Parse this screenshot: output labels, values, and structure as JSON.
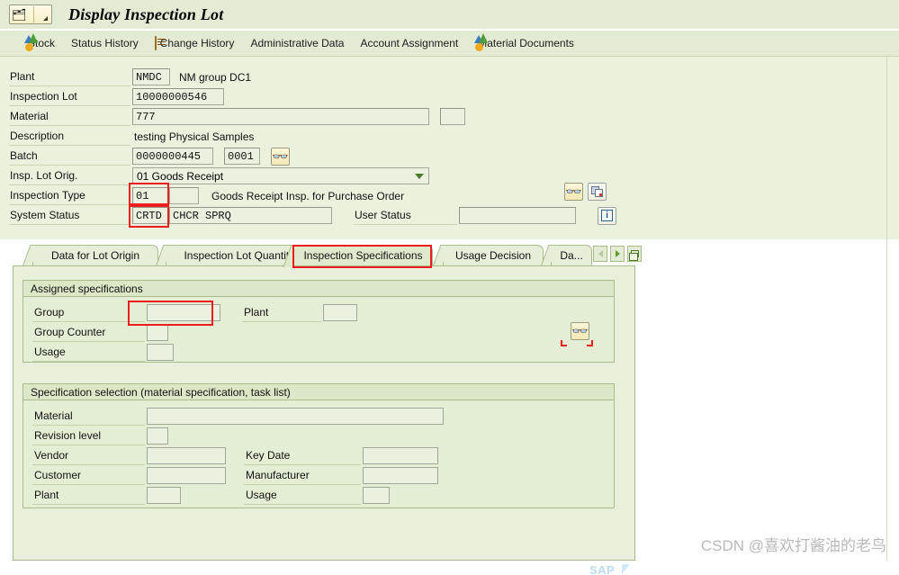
{
  "window": {
    "title": "Display Inspection Lot",
    "system_button_icon": "sap-system-menu-icon"
  },
  "toolbar": {
    "items": [
      {
        "label": "Stock",
        "icon": "stock-mountain-icon"
      },
      {
        "label": "Status History",
        "icon": ""
      },
      {
        "label": "Change History",
        "icon": "scroll-icon"
      },
      {
        "label": "Administrative Data",
        "icon": ""
      },
      {
        "label": "Account Assignment",
        "icon": ""
      },
      {
        "label": "Material Documents",
        "icon": "stock-mountain-icon"
      }
    ]
  },
  "header_form": {
    "plant": {
      "label": "Plant",
      "value": "NMDC",
      "description": "NM group DC1"
    },
    "inspection_lot": {
      "label": "Inspection Lot",
      "value": "10000000546"
    },
    "material": {
      "label": "Material",
      "value": "777",
      "extra_value": ""
    },
    "description": {
      "label": "Description",
      "value": "testing Physical Samples"
    },
    "batch": {
      "label": "Batch",
      "value": "0000000445",
      "sub_value": "0001",
      "button_icon": "glasses-display-icon"
    },
    "insp_lot_orig": {
      "label": "Insp. Lot Orig.",
      "value": "01 Goods Receipt"
    },
    "inspection_type": {
      "label": "Inspection Type",
      "value": "01",
      "extra_value": "",
      "description": "Goods Receipt Insp. for Purchase Order"
    },
    "system_status": {
      "label": "System Status",
      "value": "CRTD",
      "value_rest": "CHCR  SPRQ"
    },
    "user_status": {
      "label": "User Status",
      "value": ""
    },
    "buttons": {
      "display_glasses": "glasses-display-icon",
      "documents": "documents-icon",
      "info": "info-icon"
    }
  },
  "tabs": {
    "items": [
      {
        "label": "Data for Lot Origin",
        "selected": false
      },
      {
        "label": "Inspection Lot Quantities",
        "selected": false
      },
      {
        "label": "Inspection Specifications",
        "selected": true
      },
      {
        "label": "Usage Decision",
        "selected": false
      },
      {
        "label": "Da...",
        "selected": false
      }
    ],
    "nav": {
      "prev_icon": "chevron-left-icon",
      "next_icon": "chevron-right-icon",
      "list_icon": "tab-list-icon"
    }
  },
  "assigned_specifications": {
    "title": "Assigned specifications",
    "fields": {
      "group": {
        "label": "Group",
        "value": ""
      },
      "plant": {
        "label": "Plant",
        "value": ""
      },
      "group_counter": {
        "label": "Group Counter",
        "value": ""
      },
      "usage": {
        "label": "Usage",
        "value": ""
      }
    },
    "button_icon": "glasses-display-icon"
  },
  "specification_selection": {
    "title": "Specification selection (material specification, task list)",
    "fields": {
      "material": {
        "label": "Material",
        "value": ""
      },
      "revision_level": {
        "label": "Revision level",
        "value": ""
      },
      "vendor": {
        "label": "Vendor",
        "value": ""
      },
      "key_date": {
        "label": "Key Date",
        "value": ""
      },
      "customer": {
        "label": "Customer",
        "value": ""
      },
      "manufacturer": {
        "label": "Manufacturer",
        "value": ""
      },
      "plant": {
        "label": "Plant",
        "value": ""
      },
      "usage": {
        "label": "Usage",
        "value": ""
      }
    }
  },
  "footer": {
    "watermark": "CSDN @喜欢打酱油的老鸟",
    "brand": "SAP"
  },
  "colors": {
    "background": "#eaf1dd",
    "toolbar": "#e3ebd5",
    "field": "#eaf2df",
    "highlight": "#ee1c1c",
    "group_header": "#dbe7c6"
  }
}
